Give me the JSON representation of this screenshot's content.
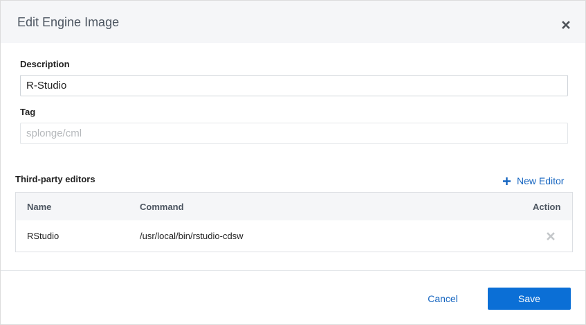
{
  "dialog": {
    "title": "Edit Engine Image",
    "close_icon": "close-icon"
  },
  "form": {
    "description_label": "Description",
    "description_value": "R-Studio",
    "tag_label": "Tag",
    "tag_placeholder": "splonge/cml"
  },
  "editors": {
    "section_title": "Third-party editors",
    "new_editor_label": "New Editor",
    "new_editor_icon": "plus-icon",
    "columns": [
      "Name",
      "Command",
      "Action"
    ],
    "rows": [
      {
        "name": "RStudio",
        "command": "/usr/local/bin/rstudio-cdsw",
        "action_icon": "close-icon"
      }
    ]
  },
  "footer": {
    "cancel_label": "Cancel",
    "save_label": "Save"
  },
  "colors": {
    "accent": "#0b6fd6",
    "link": "#1565c0",
    "header_bg": "#f5f6f8"
  }
}
